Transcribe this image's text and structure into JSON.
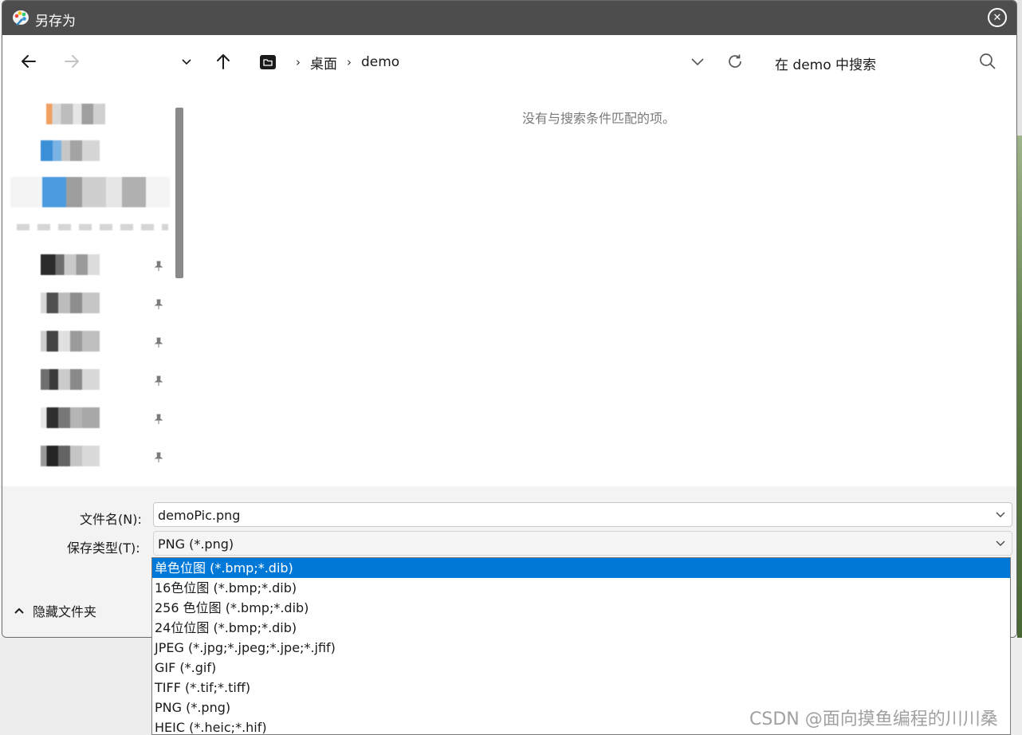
{
  "window": {
    "title": "另存为",
    "close_label": "✕"
  },
  "nav": {
    "breadcrumb": [
      "桌面",
      "demo"
    ],
    "search_placeholder": "在 demo 中搜索"
  },
  "content": {
    "empty_message": "没有与搜索条件匹配的项。"
  },
  "form": {
    "filename_label": "文件名(N):",
    "filename_value": "demoPic.png",
    "filetype_label": "保存类型(T):",
    "filetype_value": "PNG (*.png)"
  },
  "footer": {
    "hide_folders_label": "隐藏文件夹"
  },
  "filetype_options": [
    "单色位图 (*.bmp;*.dib)",
    "16色位图 (*.bmp;*.dib)",
    "256 色位图 (*.bmp;*.dib)",
    "24位位图 (*.bmp;*.dib)",
    "JPEG (*.jpg;*.jpeg;*.jpe;*.jfif)",
    "GIF (*.gif)",
    "TIFF (*.tif;*.tiff)",
    "PNG (*.png)",
    "HEIC (*.heic;*.hif)"
  ],
  "selected_option_index": 0,
  "watermark": "CSDN @面向摸鱼编程的川川桑",
  "colors": {
    "titlebar": "#4d4d4d",
    "selection": "#0078d7"
  }
}
